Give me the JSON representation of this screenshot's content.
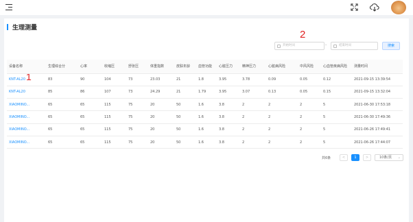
{
  "header": {
    "menu_icon": "menu-fold-icon",
    "fullscreen_icon": "fullscreen-icon",
    "cloud_icon": "cloud-download-icon",
    "avatar": "user-avatar"
  },
  "page": {
    "title": "生理测量"
  },
  "annotations": {
    "one": "1",
    "two": "2"
  },
  "filters": {
    "start_placeholder": "开始时间",
    "end_placeholder": "结束时间",
    "separator": "-",
    "search_label": "搜索"
  },
  "table": {
    "columns": [
      "设备名称",
      "生理综合分",
      "心率",
      "收缩压",
      "舒张压",
      "体重指数",
      "皮肤年龄",
      "血管功能",
      "心脏压力",
      "精神压力",
      "心脏病风险",
      "中风风险",
      "心血管疾病风险",
      "测量时间"
    ],
    "rows": [
      [
        "KNT-AL20",
        "83",
        "90",
        "104",
        "73",
        "23.03",
        "21",
        "1.8",
        "3.95",
        "3.78",
        "0.09",
        "0.05",
        "0.12",
        "2021-09-15 13:39:54"
      ],
      [
        "KNT-AL20",
        "85",
        "86",
        "107",
        "73",
        "24.29",
        "21",
        "1.79",
        "3.95",
        "3.07",
        "0.13",
        "0.05",
        "0.15",
        "2021-09-15 13:32:04"
      ],
      [
        "XIAOMINO...",
        "65",
        "65",
        "115",
        "75",
        "20",
        "50",
        "1.6",
        "3.8",
        "2",
        "2",
        "2",
        "5",
        "2021-06-30 17:53:18"
      ],
      [
        "XIAOMINO...",
        "65",
        "65",
        "115",
        "75",
        "20",
        "50",
        "1.6",
        "3.8",
        "2",
        "2",
        "2",
        "5",
        "2021-06-30 17:49:36"
      ],
      [
        "XIAOMINO...",
        "65",
        "65",
        "115",
        "75",
        "20",
        "50",
        "1.6",
        "3.8",
        "2",
        "2",
        "2",
        "5",
        "2021-06-26 17:49:41"
      ],
      [
        "XIAOMINO...",
        "65",
        "65",
        "115",
        "75",
        "20",
        "50",
        "1.6",
        "3.8",
        "2",
        "2",
        "2",
        "5",
        "2021-06-26 17:44:07"
      ]
    ]
  },
  "pagination": {
    "total_text": "共6条",
    "prev": "<",
    "current": "1",
    "next": ">",
    "page_size": "10条/页"
  },
  "colors": {
    "primary": "#1890ff",
    "annotation": "#e02020"
  }
}
